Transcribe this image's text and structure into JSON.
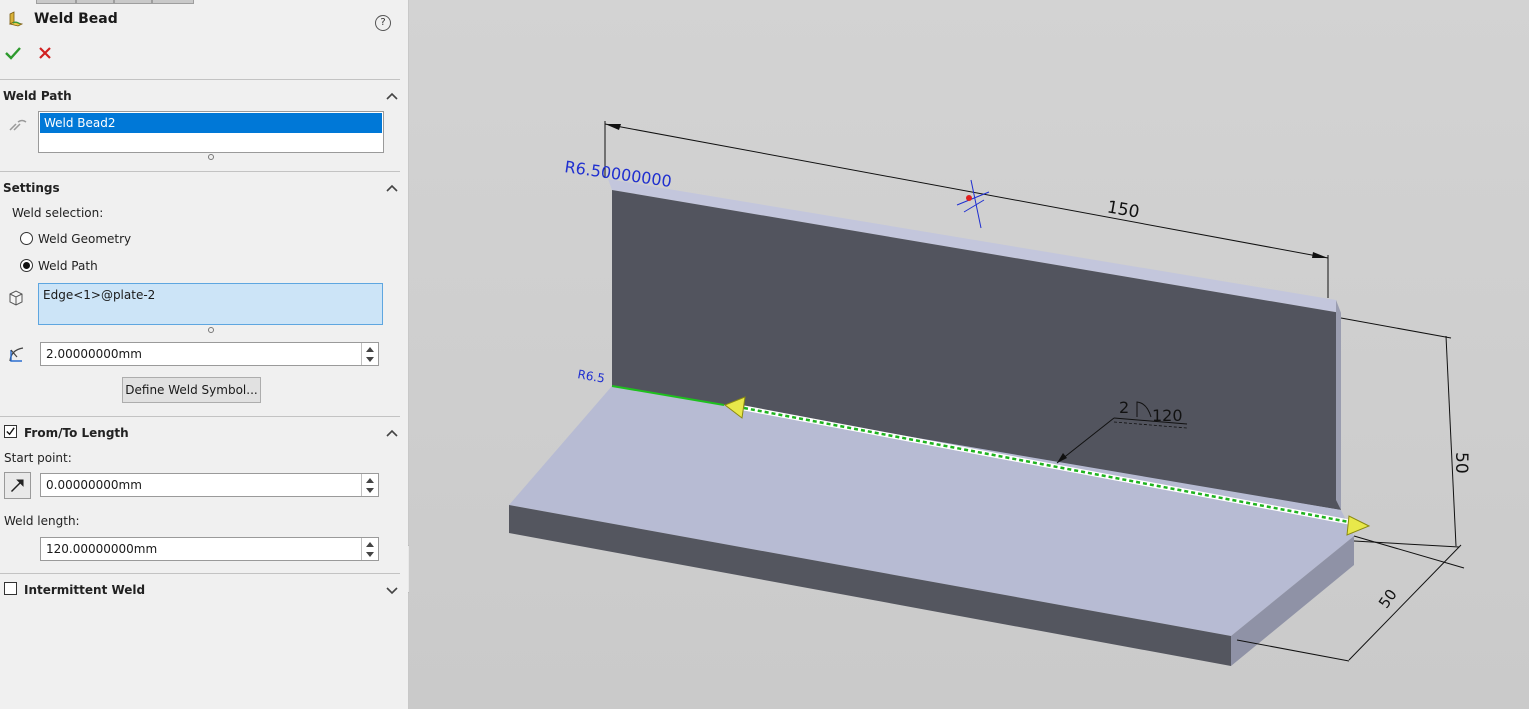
{
  "panel": {
    "title": "Weld Bead",
    "help_glyph": "?",
    "accent": "#0078d7"
  },
  "weld_path": {
    "header": "Weld Path",
    "items": [
      "Weld Bead2"
    ]
  },
  "settings": {
    "header": "Settings",
    "selection_label": "Weld selection:",
    "option_geometry": "Weld Geometry",
    "option_path": "Weld Path",
    "selected": "Weld Path",
    "edge_value": "Edge<1>@plate-2",
    "bead_size_value": "2.00000000mm",
    "define_symbol_button": "Define Weld Symbol..."
  },
  "from_to": {
    "header": "From/To Length",
    "checked": true,
    "start_label": "Start point:",
    "start_value": "0.00000000mm",
    "length_label": "Weld length:",
    "length_value": "120.00000000mm"
  },
  "intermittent": {
    "header": "Intermittent Weld",
    "checked": false
  },
  "viewport": {
    "radius_top": "R6.50000000",
    "radius_bottom": "R6.5",
    "dim_length": "150",
    "dim_height": "50",
    "dim_depth": "50",
    "weld_symbol_size": "2",
    "weld_symbol_length": "120"
  }
}
